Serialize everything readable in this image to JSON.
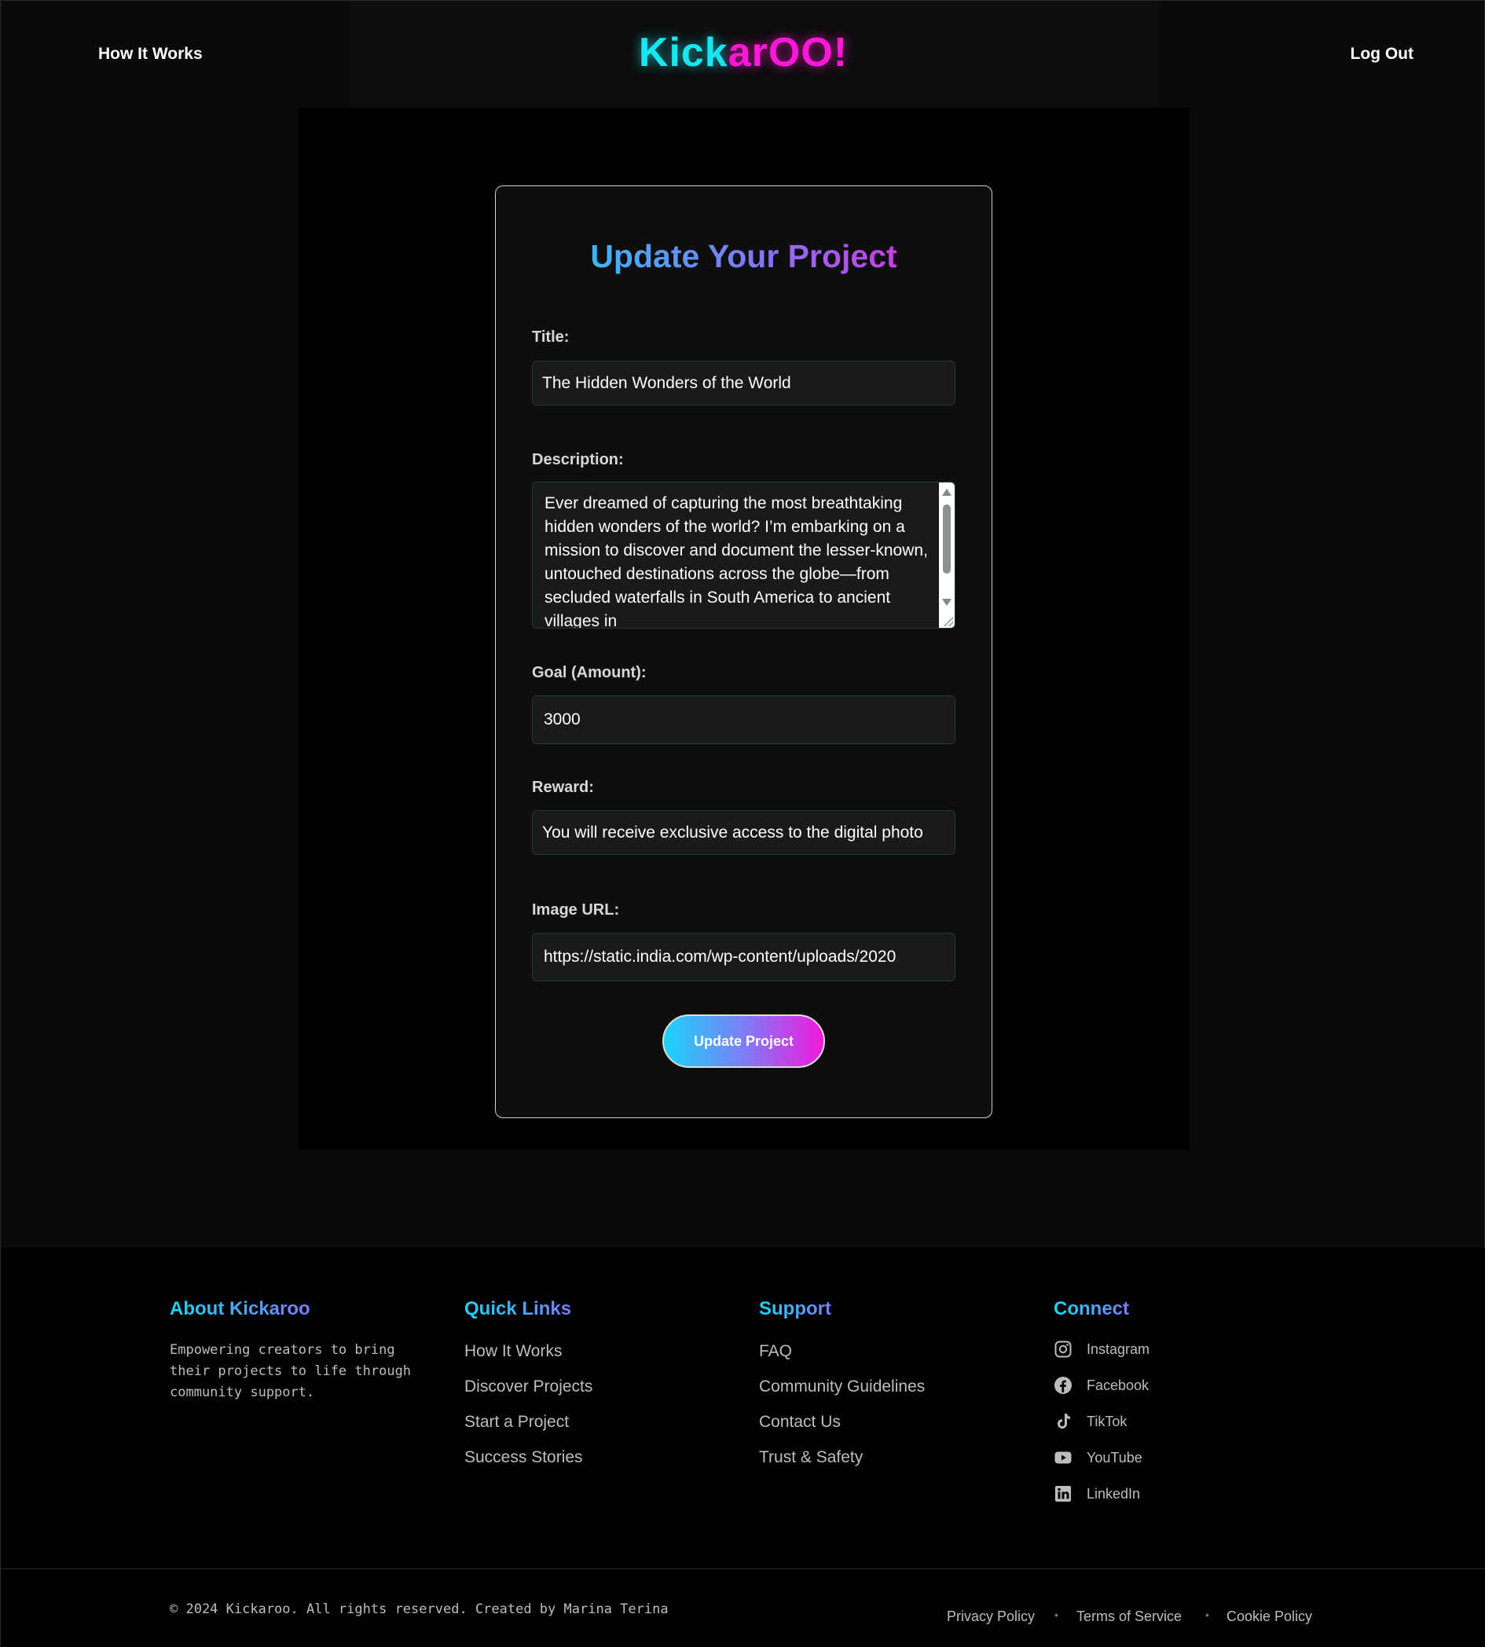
{
  "header": {
    "nav_left": "How It Works",
    "logo_part1": "Kick",
    "logo_part2": "arOO!",
    "nav_right": "Log Out"
  },
  "form": {
    "title": "Update Your Project",
    "title_label": "Title:",
    "title_value": "The Hidden Wonders of the World",
    "description_label": "Description:",
    "description_value": "Ever dreamed of capturing the most breathtaking hidden wonders of the world? I’m embarking on a mission to discover and document the lesser-known, untouched destinations across the globe—from secluded waterfalls in South America to ancient villages in",
    "goal_label": "Goal (Amount):",
    "goal_value": "3000",
    "reward_label": "Reward:",
    "reward_value": "You will receive exclusive access to the digital photo",
    "image_label": "Image URL:",
    "image_value": "https://static.india.com/wp-content/uploads/2020",
    "submit_label": "Update Project"
  },
  "footer": {
    "about_title": "About Kickaroo",
    "about_text": "Empowering creators to bring their projects to life through community support.",
    "quick_title": "Quick Links",
    "quick_links": [
      "How It Works",
      "Discover Projects",
      "Start a Project",
      "Success Stories"
    ],
    "support_title": "Support",
    "support_links": [
      "FAQ",
      "Community Guidelines",
      "Contact Us",
      "Trust & Safety"
    ],
    "connect_title": "Connect",
    "social": [
      "Instagram",
      "Facebook",
      "TikTok",
      "YouTube",
      "LinkedIn"
    ],
    "copyright": "© 2024 Kickaroo. All rights reserved. Created by Marina Terina",
    "legal": [
      "Privacy Policy",
      "Terms of Service",
      "Cookie Policy"
    ],
    "separator": "•"
  },
  "colors": {
    "accent_cyan": "#18e6f0",
    "accent_magenta": "#ff18d6",
    "accent_violet": "#7b7cf8",
    "background": "#0a0a0a"
  }
}
